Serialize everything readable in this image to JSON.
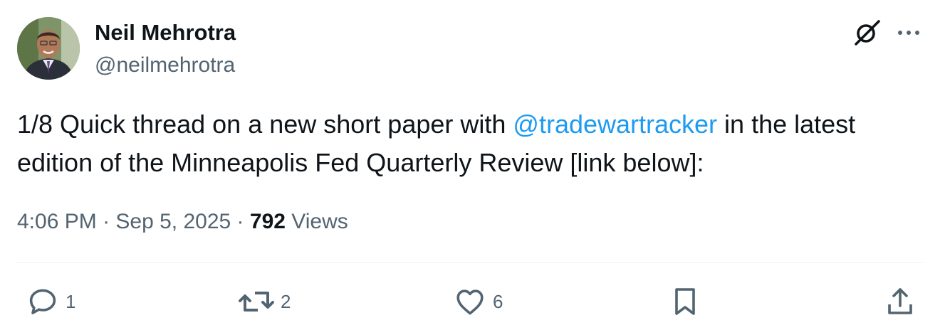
{
  "author": {
    "name": "Neil Mehrotra",
    "handle": "@neilmehrotra"
  },
  "tweet": {
    "text_before": "1/8 Quick thread on a new short paper with ",
    "mention": "@tradewartracker",
    "text_after": " in the latest edition of the Minneapolis Fed Quarterly Review [link below]:"
  },
  "meta": {
    "time": "4:06 PM",
    "separator": " · ",
    "date": "Sep 5, 2025",
    "views_count": "792",
    "views_label": " Views"
  },
  "actions": {
    "replies": "1",
    "reposts": "2",
    "likes": "6"
  },
  "icons": {
    "top_right": [
      "grok-icon",
      "more-icon"
    ],
    "actions": [
      "reply-icon",
      "repost-icon",
      "like-icon",
      "bookmark-icon",
      "share-icon"
    ]
  },
  "colors": {
    "text": "#0f1419",
    "secondary": "#536471",
    "link": "#1d9bf0",
    "divider": "#eff3f4"
  }
}
